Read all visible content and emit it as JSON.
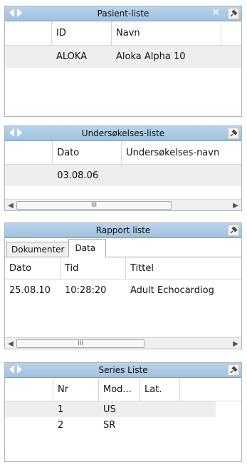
{
  "pasient": {
    "title": "Pasient-liste",
    "columns": [
      "ID",
      "Navn"
    ],
    "rows": [
      [
        "ALOKA",
        "Aloka Alpha 10"
      ]
    ]
  },
  "undersokelse": {
    "title": "Undersøkelses-liste",
    "columns": [
      "Dato",
      "Undersøkelses-navn"
    ],
    "rows": [
      [
        "03.08.06",
        ""
      ]
    ],
    "scroll_grip": "III"
  },
  "rapport": {
    "title": "Rapport liste",
    "tabs": [
      "Dokumenter",
      "Data"
    ],
    "active_tab": "Data",
    "columns": [
      "Dato",
      "Tid",
      "Tittel"
    ],
    "rows": [
      [
        "25.08.10",
        "10:28:20",
        "Adult Echocardiog"
      ]
    ],
    "scroll_grip": "III"
  },
  "series": {
    "title": "Series Liste",
    "columns": [
      "Nr",
      "Mod...",
      "Lat."
    ],
    "rows": [
      [
        "1",
        "US",
        ""
      ],
      [
        "2",
        "SR",
        ""
      ]
    ]
  },
  "icons": {
    "prev": "arrow-left-icon",
    "next": "arrow-right-icon",
    "close": "close-icon",
    "pin": "pin-icon"
  },
  "colors": {
    "titlebar": "#a9c8e6",
    "selected_row": "#eeeeee"
  }
}
